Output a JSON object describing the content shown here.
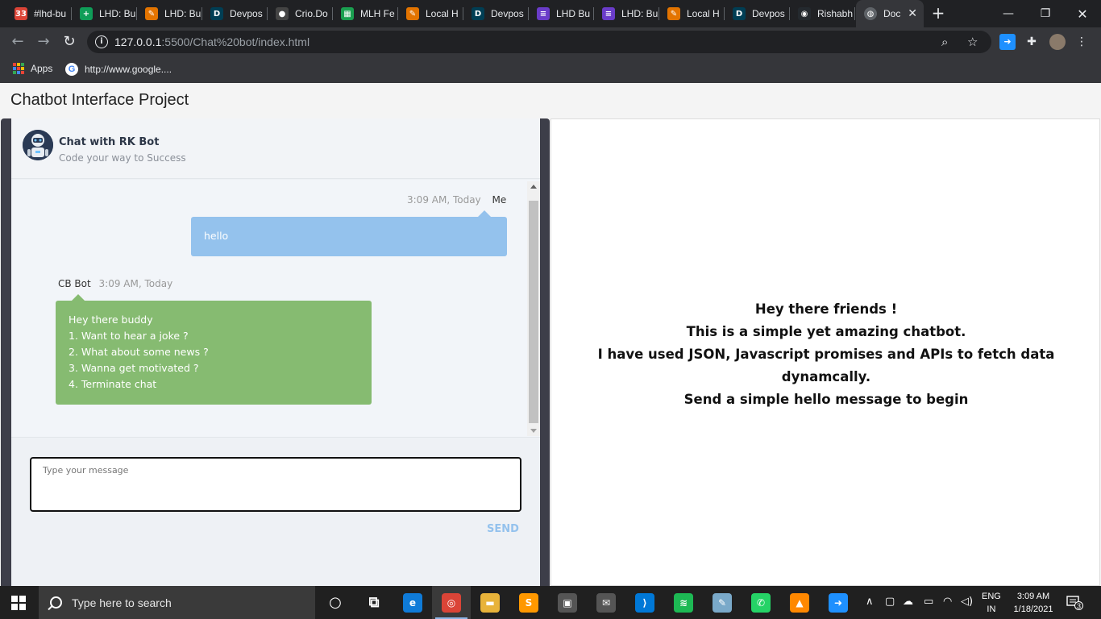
{
  "browser": {
    "tabs": [
      {
        "title": "#lhd-bu",
        "icon": "calendar-icon",
        "color": "#db4437",
        "glyph": "33"
      },
      {
        "title": "LHD: Bu",
        "icon": "sheets-icon",
        "color": "#0f9d58",
        "glyph": "+"
      },
      {
        "title": "LHD: Bu",
        "icon": "pencil-icon",
        "color": "#e37400",
        "glyph": "✎"
      },
      {
        "title": "Devpos",
        "icon": "devpost-icon",
        "color": "#003e54",
        "glyph": "D"
      },
      {
        "title": "Crio.Do",
        "icon": "crio-icon",
        "color": "#444444",
        "glyph": "●"
      },
      {
        "title": "MLH Fe",
        "icon": "mlh-icon",
        "color": "#1aa050",
        "glyph": "▦"
      },
      {
        "title": "Local H",
        "icon": "pencil-icon",
        "color": "#e37400",
        "glyph": "✎"
      },
      {
        "title": "Devpos",
        "icon": "devpost-icon",
        "color": "#003e54",
        "glyph": "D"
      },
      {
        "title": "LHD Bu",
        "icon": "list-icon",
        "color": "#6a3cc9",
        "glyph": "≡"
      },
      {
        "title": "LHD: Bu",
        "icon": "list-icon",
        "color": "#6a3cc9",
        "glyph": "≡"
      },
      {
        "title": "Local H",
        "icon": "pencil-icon",
        "color": "#e37400",
        "glyph": "✎"
      },
      {
        "title": "Devpos",
        "icon": "devpost-icon",
        "color": "#003e54",
        "glyph": "D"
      },
      {
        "title": "Rishabh",
        "icon": "github-icon",
        "color": "#24292e",
        "glyph": "◉"
      }
    ],
    "active_tab": {
      "title": "Doc",
      "icon": "globe-icon",
      "close": "✕"
    },
    "new_tab": "+",
    "window": {
      "minimize": "—",
      "restore": "❐",
      "close": "✕"
    },
    "url_host": "127.0.0.1",
    "url_rest": ":5500/Chat%20bot/index.html",
    "nav": {
      "back": "←",
      "forward": "→",
      "reload": "↻"
    },
    "bookmarks": [
      {
        "label": "Apps",
        "icon": "apps-grid-icon"
      },
      {
        "label": "http://www.google....",
        "icon": "google-icon"
      }
    ]
  },
  "page": {
    "title": "Chatbot Interface Project",
    "chat": {
      "bot_name": "Chat with RK Bot",
      "tagline": "Code your way to Success",
      "messages": {
        "me": {
          "time": "3:09 AM, Today",
          "sender": "Me",
          "text": "hello"
        },
        "bot": {
          "sender": "CB Bot",
          "time": "3:09 AM, Today",
          "lines": [
            "Hey there buddy",
            "1. Want to hear a joke ?",
            "2. What about some news ?",
            "3. Wanna get motivated ?",
            "4. Terminate chat"
          ]
        }
      },
      "input_placeholder": "Type your message",
      "send_label": "SEND"
    },
    "info": {
      "lines": [
        "Hey there friends !",
        "This is a simple yet amazing chatbot.",
        "I have used JSON, Javascript promises and APIs to fetch data dynamcally.",
        "Send a simple hello message to begin"
      ]
    }
  },
  "taskbar": {
    "search_placeholder": "Type here to search",
    "apps": [
      {
        "name": "cortana-icon",
        "glyph": "○",
        "color": "transparent"
      },
      {
        "name": "task-view-icon",
        "glyph": "⧉",
        "color": "transparent"
      },
      {
        "name": "edge-icon",
        "glyph": "e",
        "color": "#0f7bd8"
      },
      {
        "name": "chrome-icon",
        "glyph": "◎",
        "color": "#db4437"
      },
      {
        "name": "file-explorer-icon",
        "glyph": "▬",
        "color": "#e8b33a"
      },
      {
        "name": "sublime-icon",
        "glyph": "S",
        "color": "#ff9800"
      },
      {
        "name": "store-icon",
        "glyph": "▣",
        "color": "#555555"
      },
      {
        "name": "mail-icon",
        "glyph": "✉",
        "color": "#555555"
      },
      {
        "name": "vscode-icon",
        "glyph": "⟩",
        "color": "#0078d7"
      },
      {
        "name": "spotify-icon",
        "glyph": "≋",
        "color": "#1db954"
      },
      {
        "name": "notepad-icon",
        "glyph": "✎",
        "color": "#7aa9c9"
      },
      {
        "name": "whatsapp-icon",
        "glyph": "✆",
        "color": "#25d366"
      },
      {
        "name": "vlc-icon",
        "glyph": "▲",
        "color": "#ff8800"
      },
      {
        "name": "send-to-icon",
        "glyph": "➜",
        "color": "#1e90ff"
      }
    ],
    "lang_1": "ENG",
    "lang_2": "IN",
    "time": "3:09 AM",
    "date": "1/18/2021",
    "notif_count": "3"
  },
  "colors": {
    "accent": "#94c2ed",
    "bot_bubble": "#86bb71",
    "panel_dark": "#3d3e49"
  }
}
